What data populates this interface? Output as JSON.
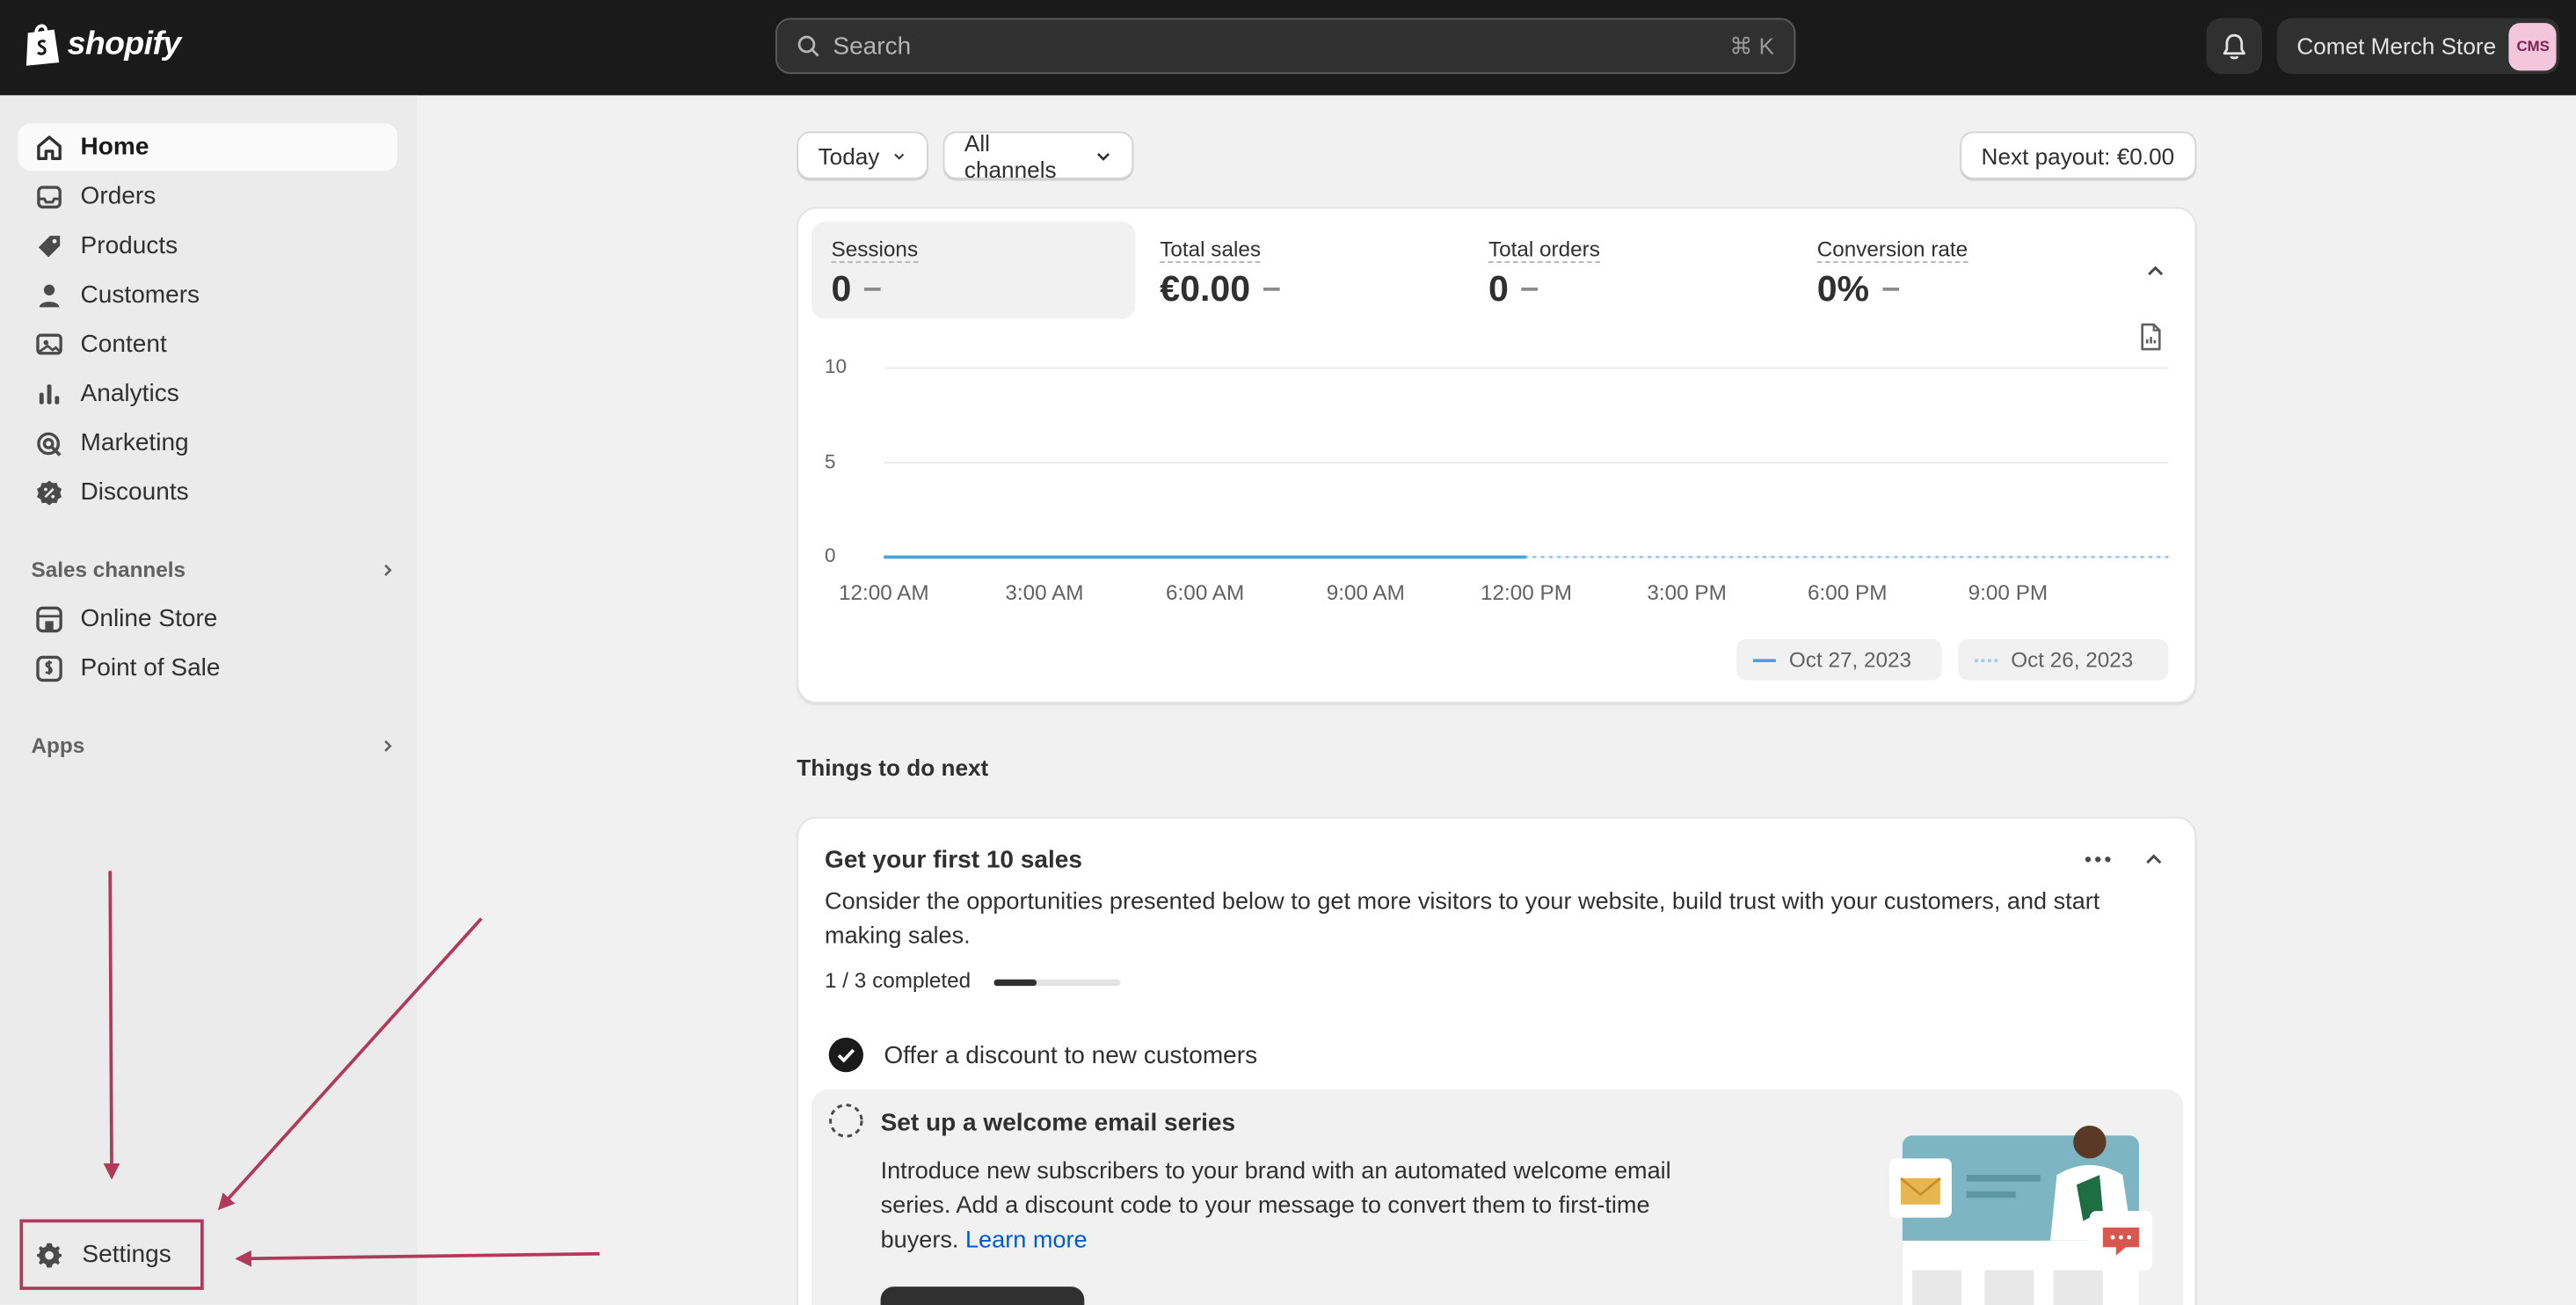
{
  "topbar": {
    "logo_text": "shopify",
    "search_placeholder": "Search",
    "search_shortcut": "⌘ K",
    "store_name": "Comet Merch Store",
    "avatar_initials": "CMS"
  },
  "sidebar": {
    "items": [
      {
        "label": "Home",
        "icon": "home-icon",
        "active": true
      },
      {
        "label": "Orders",
        "icon": "inbox-icon"
      },
      {
        "label": "Products",
        "icon": "tag-icon"
      },
      {
        "label": "Customers",
        "icon": "person-icon"
      },
      {
        "label": "Content",
        "icon": "image-icon"
      },
      {
        "label": "Analytics",
        "icon": "bar-chart-icon"
      },
      {
        "label": "Marketing",
        "icon": "target-icon"
      },
      {
        "label": "Discounts",
        "icon": "discount-icon"
      }
    ],
    "sales_channels_title": "Sales channels",
    "channels": [
      {
        "label": "Online Store",
        "icon": "store-icon"
      },
      {
        "label": "Point of Sale",
        "icon": "pos-icon"
      }
    ],
    "apps_title": "Apps",
    "settings_label": "Settings"
  },
  "filters": {
    "date": "Today",
    "channels": "All channels",
    "payout": "Next payout: €0.00"
  },
  "metrics": [
    {
      "label": "Sessions",
      "value": "0"
    },
    {
      "label": "Total sales",
      "value": "€0.00"
    },
    {
      "label": "Total orders",
      "value": "0"
    },
    {
      "label": "Conversion rate",
      "value": "0%"
    }
  ],
  "chart_data": {
    "type": "line",
    "title": "",
    "xlabel": "",
    "ylabel": "",
    "ylim": [
      0,
      10
    ],
    "yticks": [
      "10",
      "5",
      "0"
    ],
    "categories": [
      "12:00 AM",
      "3:00 AM",
      "6:00 AM",
      "9:00 AM",
      "12:00 PM",
      "3:00 PM",
      "6:00 PM",
      "9:00 PM"
    ],
    "series": [
      {
        "name": "Oct 27, 2023",
        "values": [
          0,
          0,
          0,
          0,
          0
        ],
        "style": "solid",
        "color": "#4aa3d8"
      },
      {
        "name": "Oct 26, 2023",
        "values": [
          0,
          0,
          0,
          0,
          0,
          0,
          0,
          0
        ],
        "style": "dotted",
        "color": "#9fcbe6"
      }
    ],
    "grid": true,
    "legend": "bottom-right"
  },
  "things": {
    "title": "Things to do next",
    "task_title": "Get your first 10 sales",
    "task_desc": "Consider the opportunities presented below to get more visitors to your website, build trust with your customers, and start making sales.",
    "progress_text": "1 / 3 completed",
    "progress": 0.333,
    "step1": "Offer a discount to new customers",
    "step2_title": "Set up a welcome email series",
    "step2_desc": "Introduce new subscribers to your brand with an automated welcome email series. Add a discount code to your message to convert them to first-time buyers.",
    "step2_link": "Learn more"
  },
  "colors": {
    "accent": "#b03a5b",
    "topbar": "#1a1a1a",
    "link": "#005bd3"
  }
}
